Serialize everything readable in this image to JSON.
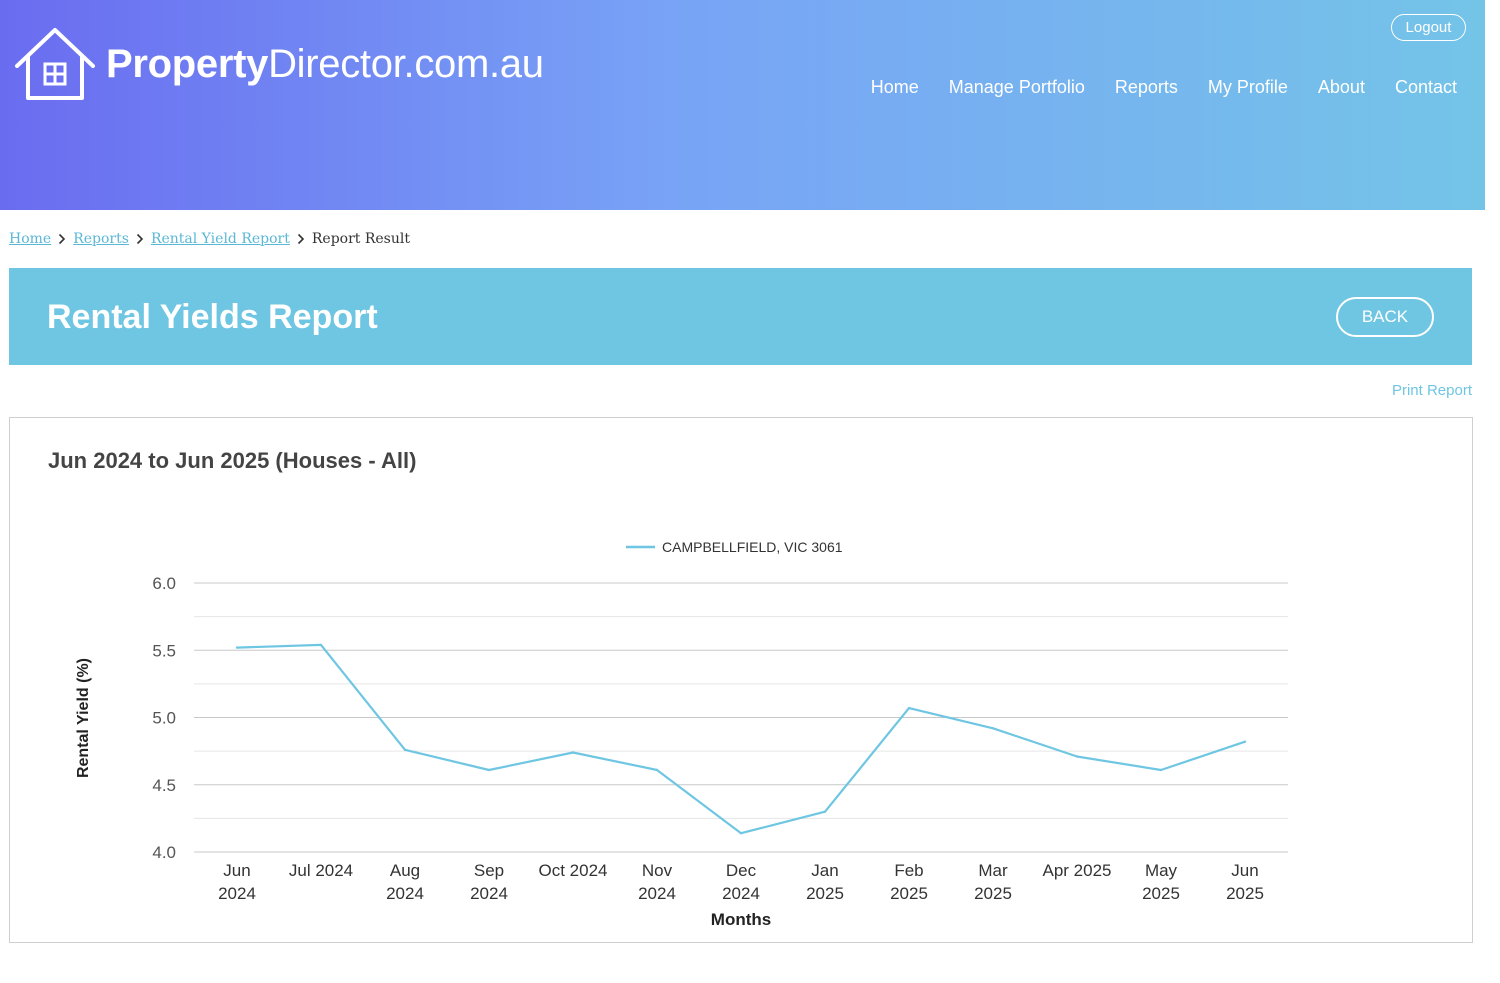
{
  "header": {
    "logo_bold": "Property",
    "logo_light": "Director.com.au",
    "logout_label": "Logout",
    "nav": [
      "Home",
      "Manage Portfolio",
      "Reports",
      "My Profile",
      "About",
      "Contact"
    ]
  },
  "breadcrumb": {
    "items": [
      "Home",
      "Reports",
      "Rental Yield Report"
    ],
    "current": "Report Result"
  },
  "banner": {
    "title": "Rental Yields Report",
    "back_label": "BACK"
  },
  "print_label": "Print Report",
  "chart_data": {
    "type": "line",
    "title": "Jun 2024 to Jun 2025 (Houses - All)",
    "xlabel": "Months",
    "ylabel": "Rental Yield (%)",
    "ylim": [
      4.0,
      6.0
    ],
    "yticks": [
      "4.0",
      "4.5",
      "5.0",
      "5.5",
      "6.0"
    ],
    "categories": [
      [
        "Jun",
        "2024"
      ],
      [
        "Jul 2024"
      ],
      [
        "Aug",
        "2024"
      ],
      [
        "Sep",
        "2024"
      ],
      [
        "Oct 2024"
      ],
      [
        "Nov",
        "2024"
      ],
      [
        "Dec",
        "2024"
      ],
      [
        "Jan",
        "2025"
      ],
      [
        "Feb",
        "2025"
      ],
      [
        "Mar",
        "2025"
      ],
      [
        "Apr 2025"
      ],
      [
        "May",
        "2025"
      ],
      [
        "Jun",
        "2025"
      ]
    ],
    "series": [
      {
        "name": "CAMPBELLFIELD, VIC 3061",
        "values": [
          5.52,
          5.54,
          4.76,
          4.61,
          4.74,
          4.61,
          4.14,
          4.3,
          5.07,
          4.92,
          4.71,
          4.61,
          4.82
        ]
      }
    ],
    "grid": true,
    "legend": "top-center",
    "colors": {
      "line": "#6fc6e2",
      "grid_major": "#c8c8c8",
      "grid_minor": "#e6e6e6"
    }
  }
}
